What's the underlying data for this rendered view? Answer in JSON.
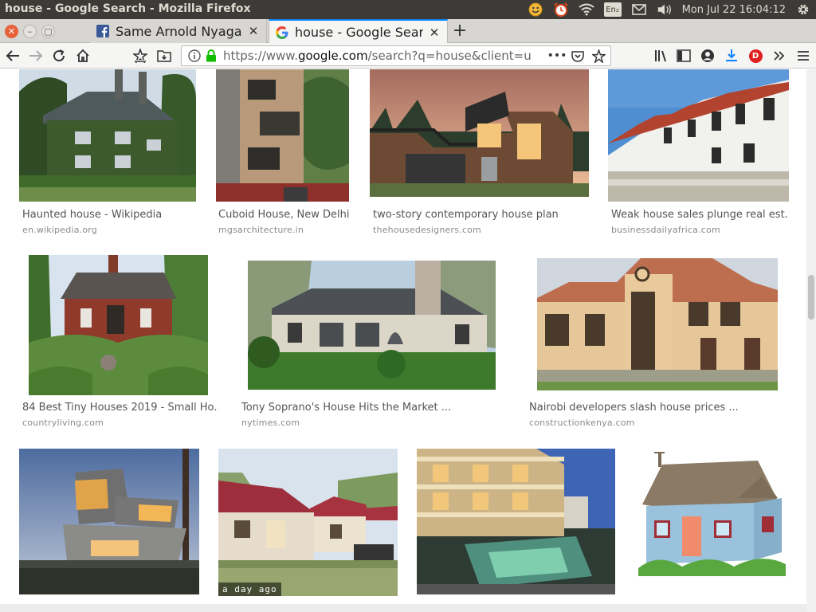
{
  "os": {
    "window_title": "house - Google Search - Mozilla Firefox",
    "keyboard": "En₂",
    "clock": "Mon Jul 22 16:04:12",
    "icons": [
      "smiley-icon",
      "alarm-clock-icon",
      "wifi-icon",
      "keyboard-layout-icon",
      "mail-icon",
      "volume-icon",
      "settings-gear-icon"
    ]
  },
  "tabs": [
    {
      "title": "Same Arnold Nyaga",
      "favicon": "facebook-icon",
      "active": false
    },
    {
      "title": "house - Google Search",
      "favicon": "google-icon",
      "active": true
    }
  ],
  "nav": {
    "url_prefix": "https://www.",
    "url_domain": "google.com",
    "url_rest": "/search?q=house&client=u",
    "profile_badge": "D"
  },
  "results": [
    {
      "title": "Haunted house - Wikipedia",
      "source": "en.wikipedia.org",
      "image": "haunted-house"
    },
    {
      "title": "Cuboid House, New Delhi",
      "source": "mgsarchitecture.in",
      "image": "cuboid-house"
    },
    {
      "title": "two-story contemporary house plan",
      "source": "thehousedesigners.com",
      "image": "contemporary-house"
    },
    {
      "title": "Weak house sales plunge real est...",
      "source": "businessdailyafrica.com",
      "image": "townhouses"
    },
    {
      "title": "84 Best Tiny Houses 2019 - Small Ho...",
      "source": "countryliving.com",
      "image": "tiny-house"
    },
    {
      "title": "Tony Soprano's House Hits the Market ...",
      "source": "nytimes.com",
      "image": "soprano-house"
    },
    {
      "title": "Nairobi developers slash house prices ...",
      "source": "constructionkenya.com",
      "image": "nairobi-house"
    },
    {
      "title": "",
      "source": "",
      "image": "modern-cantilever-house"
    },
    {
      "title": "",
      "source": "",
      "image": "red-roof-houses",
      "badge": "a day ago"
    },
    {
      "title": "",
      "source": "",
      "image": "pool-villa"
    },
    {
      "title": "",
      "source": "",
      "image": "cartoon-house"
    }
  ]
}
